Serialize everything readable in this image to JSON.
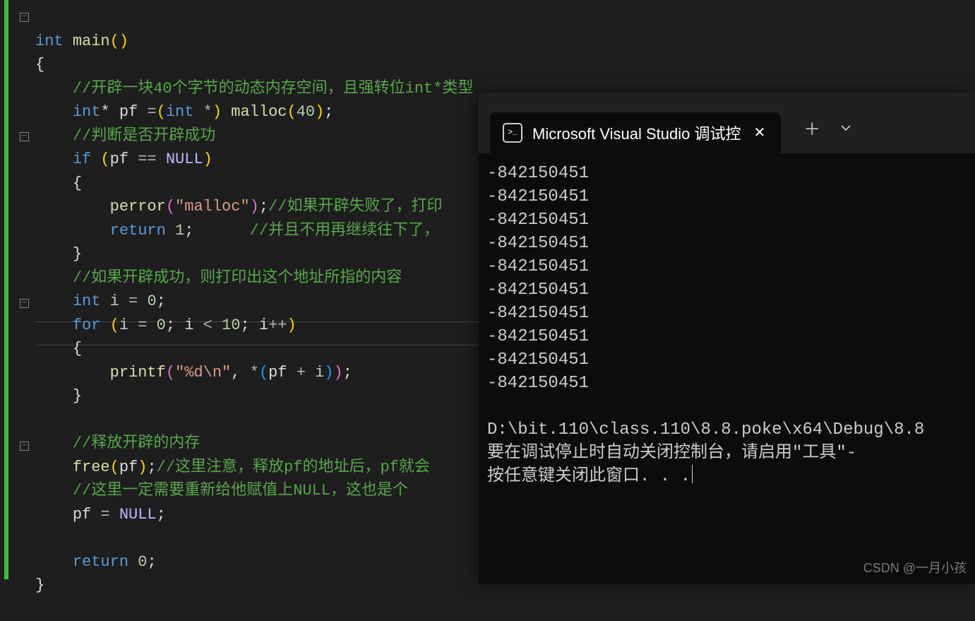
{
  "code": {
    "l0": {
      "kw": "int ",
      "fn": "main",
      "p": "()"
    },
    "l1": "{",
    "l2": "//开辟一块40个字节的动态内存空间，且强转位int*类型",
    "l3": {
      "a": "int",
      "b": "* pf ",
      "c": "=",
      "d": "(",
      "e": "int ",
      "f": "*",
      "g": ") ",
      "h": "malloc",
      "i": "(",
      "j": "40",
      "k": ")",
      "l": ";"
    },
    "l4": "//判断是否开辟成功",
    "l5": {
      "a": "if ",
      "b": "(",
      "c": "pf ",
      "d": "== ",
      "e": "NULL",
      "f": ")"
    },
    "l6": "{",
    "l7": {
      "a": "perror",
      "b": "(",
      "c": "\"malloc\"",
      "d": ")",
      "e": ";",
      "f": "//如果开辟失败了，打印"
    },
    "l8": {
      "a": "return ",
      "b": "1",
      "c": ";      ",
      "d": "//并且不用再继续往下了，"
    },
    "l9": "}",
    "l10": "//如果开辟成功，则打印出这个地址所指的内容",
    "l11": {
      "a": "int ",
      "b": "i ",
      "c": "= ",
      "d": "0",
      "e": ";"
    },
    "l12": {
      "a": "for ",
      "b": "(",
      "c": "i ",
      "d": "= ",
      "e": "0",
      "f": "; i ",
      "g": "< ",
      "h": "10",
      "i": "; i",
      "j": "++",
      "k": ")"
    },
    "l13": "{",
    "l14": {
      "a": "printf",
      "b": "(",
      "c": "\"%d\\n\"",
      "d": ", ",
      "e": "*",
      "f": "(",
      "g": "pf ",
      "h": "+ ",
      "i": "i",
      "j": ")",
      "k": ")",
      "l": ";"
    },
    "l15": "}",
    "l17": "//释放开辟的内存",
    "l18": {
      "a": "free",
      "b": "(",
      "c": "pf",
      "d": ")",
      "e": ";",
      "f": "//这里注意，释放pf的地址后，pf就会"
    },
    "l19": "//这里一定需要重新给他赋值上NULL，这也是个",
    "l20": {
      "a": "pf ",
      "b": "= ",
      "c": "NULL",
      "d": ";"
    },
    "l22": {
      "a": "return ",
      "b": "0",
      "c": ";"
    },
    "l23": "}"
  },
  "fold": {
    "minus": "−"
  },
  "terminal": {
    "tab_title": "Microsoft Visual Studio 调试控",
    "lines": [
      "-842150451",
      "-842150451",
      "-842150451",
      "-842150451",
      "-842150451",
      "-842150451",
      "-842150451",
      "-842150451",
      "-842150451",
      "-842150451"
    ],
    "path": "D:\\bit.110\\class.110\\8.8.poke\\x64\\Debug\\8.8",
    "msg1": "要在调试停止时自动关闭控制台，请启用\"工具\"-",
    "msg2": "按任意键关闭此窗口. . ."
  },
  "watermark": "CSDN @一月小孩"
}
